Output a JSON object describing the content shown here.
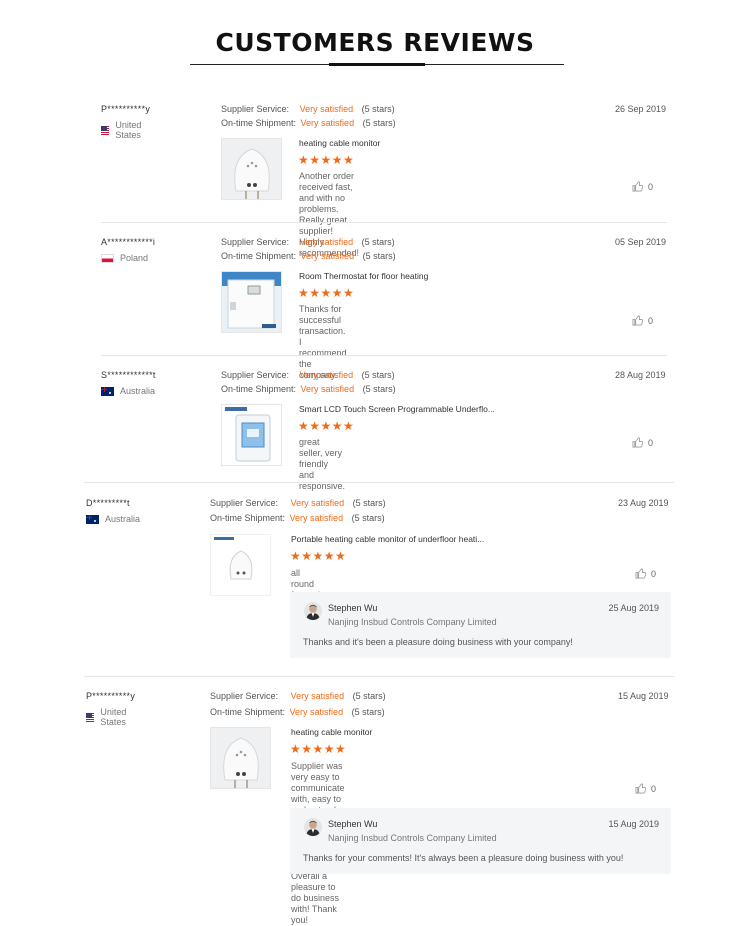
{
  "header": {
    "title": "CUSTOMERS REVIEWS"
  },
  "reviews": [
    {
      "user": "P**********y",
      "country": "United States",
      "flag": "us",
      "supplier_label": "Supplier Service:",
      "supplier_value": "Very satisfied",
      "supplier_stars": "(5 stars)",
      "shipment_label": "On-time Shipment:",
      "shipment_value": "Very satisfied",
      "shipment_stars": "(5 stars)",
      "date": "26 Sep 2019",
      "product": "heating cable monitor",
      "stars": "★★★★★",
      "comment_lines": [
        "Another order received fast, and with no problems. Really great supplier!",
        "Highly recommended!"
      ],
      "likes": "0"
    },
    {
      "user": "A************i",
      "country": "Poland",
      "flag": "pl",
      "supplier_label": "Supplier Service:",
      "supplier_value": "Very satisfied",
      "supplier_stars": "(5 stars)",
      "shipment_label": "On-time Shipment:",
      "shipment_value": "Very satisfied",
      "shipment_stars": "(5 stars)",
      "date": "05 Sep 2019",
      "product": "Room Thermostat for floor heating",
      "stars": "★★★★★",
      "comment_lines": [
        "Thanks for successful transaction.",
        "I recommend the company."
      ],
      "likes": "0"
    },
    {
      "user": "S************t",
      "country": "Australia",
      "flag": "au",
      "supplier_label": "Supplier Service:",
      "supplier_value": "Very satisfied",
      "supplier_stars": "(5 stars)",
      "shipment_label": "On-time Shipment:",
      "shipment_value": "Very satisfied",
      "shipment_stars": "(5 stars)",
      "date": "28 Aug 2019",
      "product": "Smart LCD Touch Screen Programmable Underflo...",
      "stars": "★★★★★",
      "comment_lines": [
        "great seller, very friendly and responsive."
      ],
      "likes": "0"
    },
    {
      "user": "D*********t",
      "country": "Australia",
      "flag": "au",
      "supplier_label": "Supplier Service:",
      "supplier_value": "Very satisfied",
      "supplier_stars": "(5 stars)",
      "shipment_label": "On-time Shipment:",
      "shipment_value": "Very satisfied",
      "shipment_stars": "(5 stars)",
      "date": "23 Aug 2019",
      "product": "Portable heating cable monitor of underfloor heati...",
      "stars": "★★★★★",
      "comment_lines": [
        "all round fantastic to deal with"
      ],
      "likes": "0",
      "reply": {
        "name": "Stephen Wu",
        "company": "Nanjing Insbud Controls Company Limited",
        "date": "25 Aug 2019",
        "text": "Thanks and it's been a pleasure doing business with your company!"
      }
    },
    {
      "user": "P**********y",
      "country": "United States",
      "flag": "us",
      "supplier_label": "Supplier Service:",
      "supplier_value": "Very satisfied",
      "supplier_stars": "(5 stars)",
      "shipment_label": "On-time Shipment:",
      "shipment_value": "Very satisfied",
      "shipment_stars": "(5 stars)",
      "date": "15 Aug 2019",
      "product": "heating cable monitor",
      "stars": "★★★★★",
      "comment_lines": [
        "Supplier was very easy to communicate with, easy to understand and pro",
        "cessed our order quickly and efficiently. Overall a pleasure to do business",
        "with! Thank you!"
      ],
      "likes": "0",
      "reply": {
        "name": "Stephen Wu",
        "company": "Nanjing Insbud Controls Company Limited",
        "date": "15 Aug 2019",
        "text": "Thanks for your comments! It's always been a pleasure doing business with you!"
      }
    }
  ],
  "colors": {
    "accent": "#ee6b1a",
    "text": "#333333",
    "muted": "#777777",
    "reply_bg": "#f4f5f7"
  }
}
